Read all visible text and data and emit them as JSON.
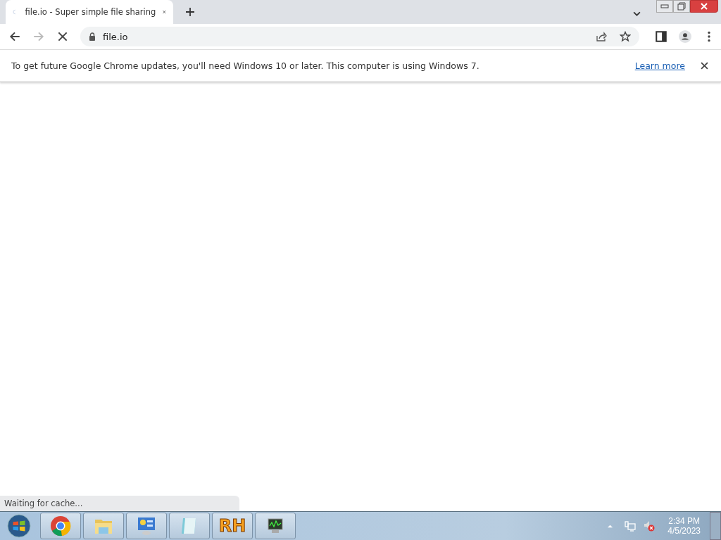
{
  "tab": {
    "title": "file.io - Super simple file sharing",
    "loading": true
  },
  "toolbar": {
    "address": "file.io",
    "loading": true
  },
  "infobar": {
    "message": "To get future Google Chrome updates, you'll need Windows 10 or later. This computer is using Windows 7.",
    "link": "Learn more"
  },
  "status_bubble": "Waiting for cache...",
  "taskbar": {
    "apps": [
      {
        "kind": "chrome"
      },
      {
        "kind": "explorer"
      },
      {
        "kind": "control-panel"
      },
      {
        "kind": "notepad"
      },
      {
        "kind": "rh",
        "label": "RH"
      },
      {
        "kind": "monitor"
      }
    ],
    "time": "2:34 PM",
    "date": "4/5/2023"
  }
}
